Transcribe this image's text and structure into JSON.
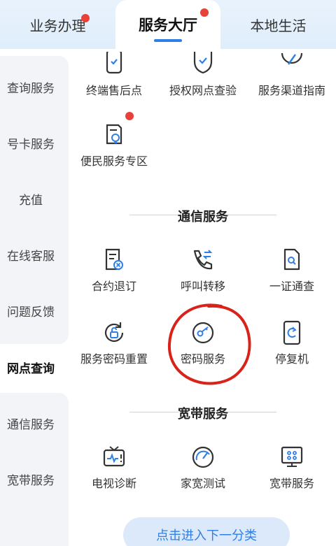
{
  "tabs": {
    "left": "业务办理",
    "middle": "服务大厅",
    "right": "本地生活"
  },
  "sidebar": {
    "items": [
      {
        "label": "查询服务"
      },
      {
        "label": "号卡服务"
      },
      {
        "label": "充值"
      },
      {
        "label": "在线客服"
      },
      {
        "label": "问题反馈"
      },
      {
        "label": "网点查询"
      },
      {
        "label": "通信服务"
      },
      {
        "label": "宽带服务"
      }
    ]
  },
  "top_services": [
    {
      "label": "终端售后点",
      "icon": "device-repair-icon"
    },
    {
      "label": "授权网点查验",
      "icon": "shield-check-icon"
    },
    {
      "label": "服务渠道指南",
      "icon": "compass-icon"
    },
    {
      "label": "便民服务专区",
      "icon": "lightbulb-document-icon"
    }
  ],
  "sections": {
    "telecom": {
      "title": "通信服务",
      "items": [
        {
          "label": "合约退订",
          "icon": "contract-cancel-icon"
        },
        {
          "label": "呼叫转移",
          "icon": "phone-transfer-icon"
        },
        {
          "label": "一证通查",
          "icon": "id-search-icon"
        },
        {
          "label": "服务密码重置",
          "icon": "lock-reset-icon"
        },
        {
          "label": "密码服务",
          "icon": "key-icon"
        },
        {
          "label": "停复机",
          "icon": "phone-suspend-icon"
        }
      ]
    },
    "broadband": {
      "title": "宽带服务",
      "items": [
        {
          "label": "电视诊断",
          "icon": "tv-diagnose-icon"
        },
        {
          "label": "家宽测试",
          "icon": "speed-gauge-icon"
        },
        {
          "label": "宽带服务",
          "icon": "router-icon"
        }
      ]
    }
  },
  "next_button": {
    "label": "点击进入下一分类"
  },
  "colors": {
    "accent": "#2f7fe6",
    "badge": "#e8413a",
    "annotation": "#d8231a"
  }
}
